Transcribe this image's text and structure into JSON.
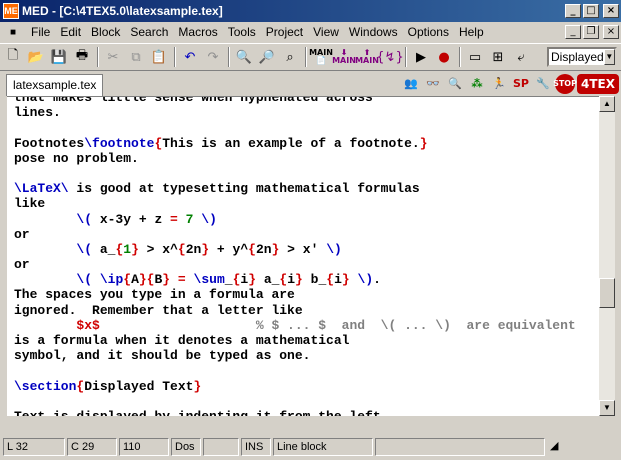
{
  "window": {
    "title": "MED - [C:\\4TEX5.0\\latexsample.tex]",
    "app_icon_label": "ME",
    "buttons": {
      "minimize": "_",
      "maximize": "□",
      "close": "×"
    },
    "doc_buttons": {
      "minimize": "_",
      "restore": "❐",
      "close": "×"
    }
  },
  "menu": {
    "items": [
      "File",
      "Edit",
      "Block",
      "Search",
      "Macros",
      "Tools",
      "Project",
      "View",
      "Windows",
      "Options",
      "Help"
    ]
  },
  "toolbar": {
    "display_mode": "Displayed",
    "main_labels": [
      "MAIN",
      "MAIN",
      "MAIN"
    ]
  },
  "tabs": [
    {
      "label": "latexsample.tex",
      "active": true
    }
  ],
  "tex_icons": {
    "stop_label": "STOP",
    "sp_label": "SP",
    "tex_label": "4TEX"
  },
  "editor": {
    "lines": [
      [
        {
          "t": "that makes little sense when hyphenated across",
          "c": "txt"
        }
      ],
      [
        {
          "t": "lines.",
          "c": "txt"
        }
      ],
      [
        {
          "t": "",
          "c": "txt"
        }
      ],
      [
        {
          "t": "Footnotes",
          "c": "txt"
        },
        {
          "t": "\\footnote",
          "c": "cmd"
        },
        {
          "t": "{",
          "c": "brace"
        },
        {
          "t": "This is an example of a footnote.",
          "c": "txt"
        },
        {
          "t": "}",
          "c": "brace"
        }
      ],
      [
        {
          "t": "pose no problem.",
          "c": "txt"
        }
      ],
      [
        {
          "t": "",
          "c": "txt"
        }
      ],
      [
        {
          "t": "\\LaTeX\\",
          "c": "cmd"
        },
        {
          "t": " is good at typesetting mathematical formulas",
          "c": "txt"
        }
      ],
      [
        {
          "t": "like",
          "c": "txt"
        }
      ],
      [
        {
          "t": "        ",
          "c": "txt"
        },
        {
          "t": "\\(",
          "c": "cmd"
        },
        {
          "t": " x-3y + z ",
          "c": "txt"
        },
        {
          "t": "=",
          "c": "op"
        },
        {
          "t": " ",
          "c": "txt"
        },
        {
          "t": "7",
          "c": "num"
        },
        {
          "t": " ",
          "c": "txt"
        },
        {
          "t": "\\)",
          "c": "cmd"
        }
      ],
      [
        {
          "t": "or",
          "c": "txt"
        }
      ],
      [
        {
          "t": "        ",
          "c": "txt"
        },
        {
          "t": "\\(",
          "c": "cmd"
        },
        {
          "t": " a_",
          "c": "txt"
        },
        {
          "t": "{",
          "c": "brace"
        },
        {
          "t": "1",
          "c": "num"
        },
        {
          "t": "}",
          "c": "brace"
        },
        {
          "t": " > x^",
          "c": "txt"
        },
        {
          "t": "{",
          "c": "brace"
        },
        {
          "t": "2n",
          "c": "txt"
        },
        {
          "t": "}",
          "c": "brace"
        },
        {
          "t": " + y^",
          "c": "txt"
        },
        {
          "t": "{",
          "c": "brace"
        },
        {
          "t": "2n",
          "c": "txt"
        },
        {
          "t": "}",
          "c": "brace"
        },
        {
          "t": " > x' ",
          "c": "txt"
        },
        {
          "t": "\\)",
          "c": "cmd"
        }
      ],
      [
        {
          "t": "or",
          "c": "txt"
        }
      ],
      [
        {
          "t": "        ",
          "c": "txt"
        },
        {
          "t": "\\(",
          "c": "cmd"
        },
        {
          "t": " ",
          "c": "txt"
        },
        {
          "t": "\\ip",
          "c": "cmd"
        },
        {
          "t": "{",
          "c": "brace"
        },
        {
          "t": "A",
          "c": "txt"
        },
        {
          "t": "}{",
          "c": "brace"
        },
        {
          "t": "B",
          "c": "txt"
        },
        {
          "t": "}",
          "c": "brace"
        },
        {
          "t": " ",
          "c": "txt"
        },
        {
          "t": "=",
          "c": "op"
        },
        {
          "t": " ",
          "c": "txt"
        },
        {
          "t": "\\sum",
          "c": "cmd"
        },
        {
          "t": "_",
          "c": "txt"
        },
        {
          "t": "{",
          "c": "brace"
        },
        {
          "t": "i",
          "c": "txt"
        },
        {
          "t": "}",
          "c": "brace"
        },
        {
          "t": " a_",
          "c": "txt"
        },
        {
          "t": "{",
          "c": "brace"
        },
        {
          "t": "i",
          "c": "txt"
        },
        {
          "t": "}",
          "c": "brace"
        },
        {
          "t": " b_",
          "c": "txt"
        },
        {
          "t": "{",
          "c": "brace"
        },
        {
          "t": "i",
          "c": "txt"
        },
        {
          "t": "}",
          "c": "brace"
        },
        {
          "t": " ",
          "c": "txt"
        },
        {
          "t": "\\)",
          "c": "cmd"
        },
        {
          "t": ".",
          "c": "txt"
        }
      ],
      [
        {
          "t": "The spaces you type in a formula are",
          "c": "txt"
        }
      ],
      [
        {
          "t": "ignored.  Remember that a letter like",
          "c": "txt"
        }
      ],
      [
        {
          "t": "        ",
          "c": "txt"
        },
        {
          "t": "$x$",
          "c": "mathd"
        },
        {
          "t": "                    % $ ... $  and  \\( ... \\)  are equivalent",
          "c": "cmt"
        }
      ],
      [
        {
          "t": "is a formula when it denotes a mathematical",
          "c": "txt"
        }
      ],
      [
        {
          "t": "symbol, and it should be typed as one.",
          "c": "txt"
        }
      ],
      [
        {
          "t": "",
          "c": "txt"
        }
      ],
      [
        {
          "t": "\\section",
          "c": "cmd"
        },
        {
          "t": "{",
          "c": "brace"
        },
        {
          "t": "Displayed Text",
          "c": "txt"
        },
        {
          "t": "}",
          "c": "brace"
        }
      ],
      [
        {
          "t": "",
          "c": "txt"
        }
      ],
      [
        {
          "t": "Text is displayed by indenting it from the left",
          "c": "txt"
        }
      ]
    ]
  },
  "statusbar": {
    "line": "L  32",
    "col": "C  29",
    "value": "110",
    "format": "Dos",
    "empty": "",
    "mode": "INS",
    "block": "Line block"
  },
  "colors": {
    "title_start": "#0a246a",
    "title_end": "#3a6ea5",
    "command": "#0000c0",
    "brace": "#d00000",
    "number": "#008000",
    "comment": "#808080"
  }
}
